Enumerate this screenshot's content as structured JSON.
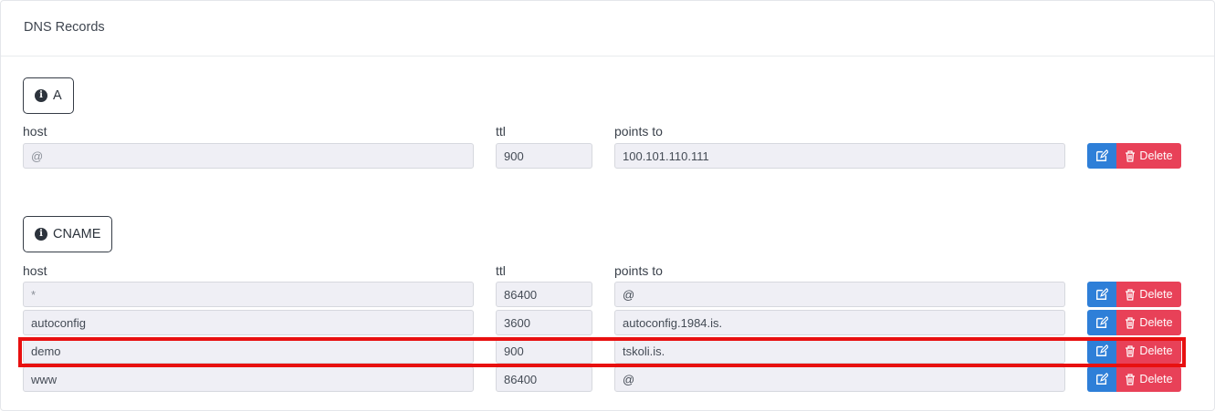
{
  "header": {
    "title": "DNS Records"
  },
  "columns": {
    "host": "host",
    "ttl": "ttl",
    "points_to": "points to"
  },
  "delete_label": "Delete",
  "groups": [
    {
      "type": "A",
      "records": [
        {
          "host": "@",
          "ttl": "900",
          "points_to": "100.101.110.111"
        }
      ]
    },
    {
      "type": "CNAME",
      "records": [
        {
          "host": "*",
          "ttl": "86400",
          "points_to": "@"
        },
        {
          "host": "autoconfig",
          "ttl": "3600",
          "points_to": "autoconfig.1984.is."
        },
        {
          "host": "demo",
          "ttl": "900",
          "points_to": "tskoli.is."
        },
        {
          "host": "www",
          "ttl": "86400",
          "points_to": "@"
        }
      ]
    }
  ],
  "colors": {
    "edit": "#2e7fd8",
    "delete": "#e84158",
    "highlight": "#e81010"
  },
  "icons": {
    "type_badge": "info-circle-icon",
    "edit": "edit-icon",
    "delete": "trash-icon"
  }
}
